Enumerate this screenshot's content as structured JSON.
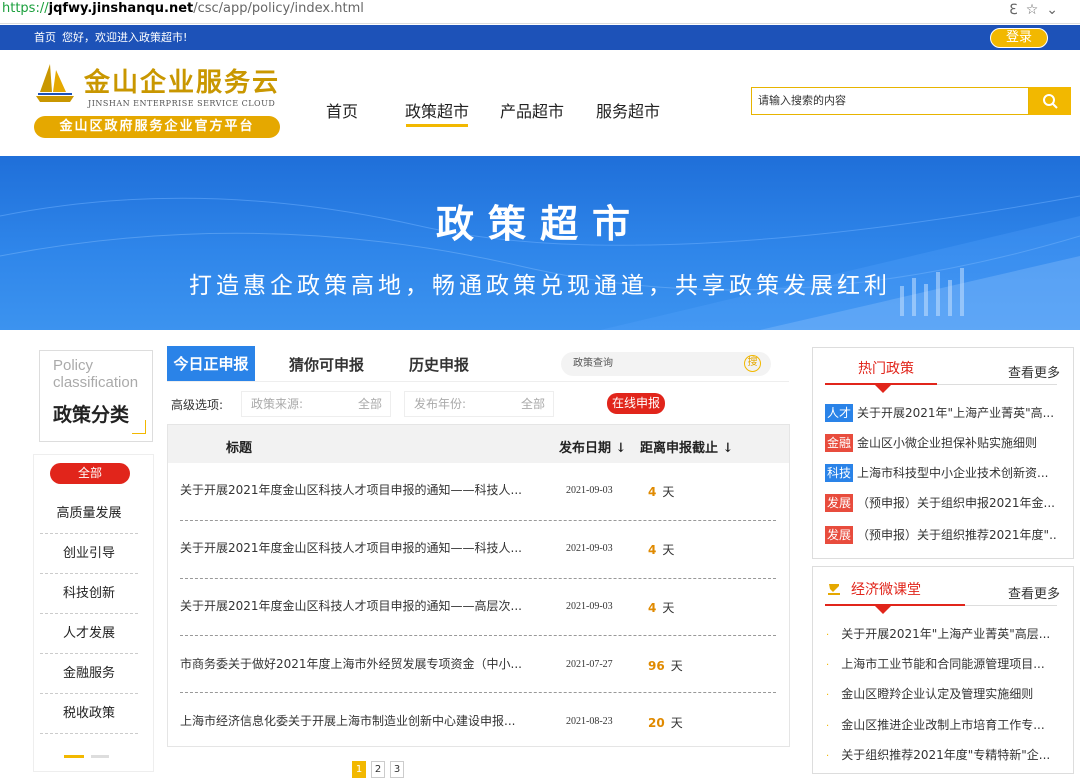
{
  "browser": {
    "url_protocol": "https://",
    "url_host": "jqfwy.jinshanqu.net",
    "url_path": "/csc/app/policy/index.html",
    "icons": [
      "reader-icon",
      "star-icon",
      "chevron-down-icon"
    ]
  },
  "topbar": {
    "home": "首页",
    "welcome": "您好，欢迎进入政策超市!",
    "login": "登录"
  },
  "logo": {
    "title": "金山企业服务云",
    "subtitle": "JINSHAN ENTERPRISE SERVICE CLOUD",
    "slogan": "金山区政府服务企业官方平台"
  },
  "nav": {
    "items": [
      "首页",
      "政策超市",
      "产品超市",
      "服务超市"
    ],
    "active": "政策超市"
  },
  "search": {
    "placeholder": "请输入搜索的内容"
  },
  "banner": {
    "title": "政策超市",
    "subtitle": "打造惠企政策高地，畅通政策兑现通道，共享政策发展红利"
  },
  "sidebar": {
    "title_en": "Policy classification",
    "title_cn": "政策分类",
    "all": "全部",
    "categories": [
      "高质量发展",
      "创业引导",
      "科技创新",
      "人才发展",
      "金融服务",
      "税收政策"
    ]
  },
  "tabs": {
    "items": [
      "今日正申报",
      "猜你可申报",
      "历史申报"
    ]
  },
  "policy_search": {
    "placeholder": "政策查询",
    "icon_text": "搜"
  },
  "filters": {
    "label": "高级选项:",
    "source_label": "政策来源:",
    "source_value": "全部",
    "year_label": "发布年份:",
    "year_value": "全部",
    "online_button": "在线申报"
  },
  "table": {
    "headers": {
      "title": "标题",
      "date": "发布日期 ↓",
      "deadline": "距离申报截止 ↓"
    },
    "day_unit": "天",
    "rows": [
      {
        "title": "关于开展2021年度金山区科技人才项目申报的通知——科技人...",
        "date": "2021-09-03",
        "days": "4"
      },
      {
        "title": "关于开展2021年度金山区科技人才项目申报的通知——科技人...",
        "date": "2021-09-03",
        "days": "4"
      },
      {
        "title": "关于开展2021年度金山区科技人才项目申报的通知——高层次...",
        "date": "2021-09-03",
        "days": "4"
      },
      {
        "title": "市商务委关于做好2021年度上海市外经贸发展专项资金（中小...",
        "date": "2021-07-27",
        "days": "96"
      },
      {
        "title": "上海市经济信息化委关于开展上海市制造业创新中心建设申报...",
        "date": "2021-08-23",
        "days": "20"
      }
    ]
  },
  "pagination": {
    "pages": [
      "1",
      "2",
      "3"
    ],
    "current": "1"
  },
  "hot_policy": {
    "title": "热门政策",
    "more": "查看更多",
    "items": [
      {
        "tag": "人才",
        "tag_color": "#2a83e8",
        "text": "关于开展2021年\"上海产业菁英\"高..."
      },
      {
        "tag": "金融",
        "tag_color": "#e84c3d",
        "text": "金山区小微企业担保补贴实施细则"
      },
      {
        "tag": "科技",
        "tag_color": "#2a83e8",
        "text": "上海市科技型中小企业技术创新资..."
      },
      {
        "tag": "发展",
        "tag_color": "#e84c3d",
        "text": "（预申报）关于组织申报2021年金..."
      },
      {
        "tag": "发展",
        "tag_color": "#e84c3d",
        "text": "（预申报）关于组织推荐2021年度\"..."
      }
    ]
  },
  "eco_class": {
    "title": "经济微课堂",
    "more": "查看更多",
    "items": [
      "关于开展2021年\"上海产业菁英\"高层...",
      "上海市工业节能和合同能源管理项目...",
      "金山区瞪羚企业认定及管理实施细则",
      "金山区推进企业改制上市培育工作专...",
      "关于组织推荐2021年度\"专精特新\"企..."
    ]
  },
  "colors": {
    "brand_blue": "#1d52b8",
    "accent_yellow": "#f2b800",
    "tab_blue": "#2a83e8",
    "red": "#e1251b",
    "days_orange": "#e08a00"
  }
}
